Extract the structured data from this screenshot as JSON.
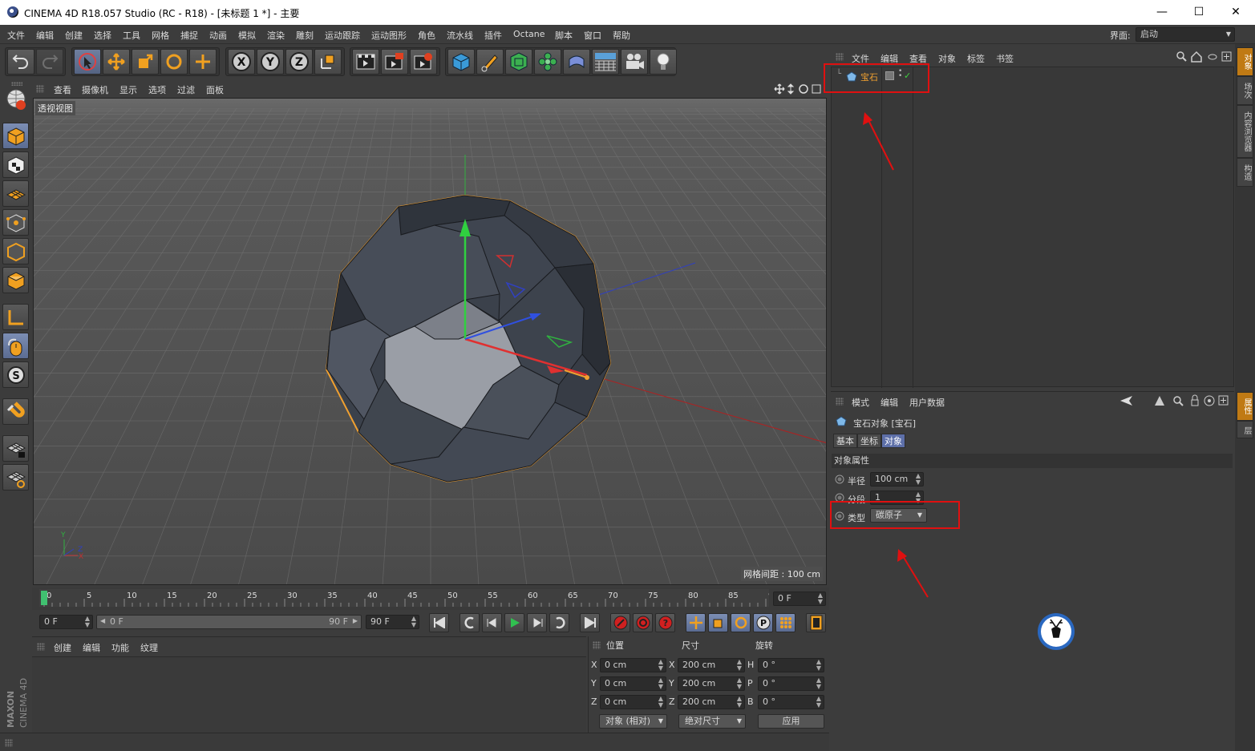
{
  "window": {
    "title": "CINEMA 4D R18.057 Studio (RC - R18) - [未标题 1 *] - 主要",
    "minimize": "—",
    "maximize": "☐",
    "close": "✕"
  },
  "menubar": {
    "items": [
      "文件",
      "编辑",
      "创建",
      "选择",
      "工具",
      "网格",
      "捕捉",
      "动画",
      "模拟",
      "渲染",
      "雕刻",
      "运动跟踪",
      "运动图形",
      "角色",
      "流水线",
      "插件",
      "Octane",
      "脚本",
      "窗口",
      "帮助"
    ],
    "layout_label": "界面:",
    "layout_value": "启动"
  },
  "toolbar": {
    "axis_x": "X",
    "axis_y": "Y",
    "axis_z": "Z",
    "icons": [
      "undo-icon",
      "redo-icon",
      "live-select-icon",
      "move-icon",
      "scale-icon",
      "rotate-icon",
      "transform-icon",
      "x-axis-icon",
      "y-axis-icon",
      "z-axis-icon",
      "coordinate-system-icon",
      "render-view-icon",
      "render-picture-viewer-icon",
      "render-settings-icon",
      "cube-icon",
      "pen-icon",
      "subdivision-icon",
      "cloner-icon",
      "deformer-icon",
      "floor-icon",
      "camera-icon",
      "light-icon"
    ]
  },
  "viewport": {
    "menu": [
      "查看",
      "摄像机",
      "显示",
      "选项",
      "过滤",
      "面板"
    ],
    "camera_label": "透视视图",
    "grid_spacing": "网格间距 : 100 cm",
    "axis_x": "X",
    "axis_y": "Y",
    "axis_z": "Z"
  },
  "timeline": {
    "ticks": [
      "0",
      "5",
      "10",
      "15",
      "20",
      "25",
      "30",
      "35",
      "40",
      "45",
      "50",
      "55",
      "60",
      "65",
      "70",
      "75",
      "80",
      "85",
      "90"
    ],
    "current_frame": "0 F"
  },
  "transport": {
    "start_frame": "0 F",
    "range_start": "0 F",
    "range_end": "90 F",
    "end_frame": "90 F"
  },
  "material_manager": {
    "menu": [
      "创建",
      "编辑",
      "功能",
      "纹理"
    ]
  },
  "coordinates": {
    "headers": [
      "位置",
      "尺寸",
      "旋转"
    ],
    "rows": [
      {
        "axis": "X",
        "pos": "0 cm",
        "size_axis": "X",
        "size": "200 cm",
        "rot_axis": "H",
        "rot": "0 °"
      },
      {
        "axis": "Y",
        "pos": "0 cm",
        "size_axis": "Y",
        "size": "200 cm",
        "rot_axis": "P",
        "rot": "0 °"
      },
      {
        "axis": "Z",
        "pos": "0 cm",
        "size_axis": "Z",
        "size": "200 cm",
        "rot_axis": "B",
        "rot": "0 °"
      }
    ],
    "mode": "对象 (相对)",
    "size_mode": "绝对尺寸",
    "apply": "应用"
  },
  "object_manager": {
    "menu": [
      "文件",
      "编辑",
      "查看",
      "对象",
      "标签",
      "书签"
    ],
    "objects": [
      {
        "name": "宝石",
        "icon": "gem-icon",
        "check": "✓"
      }
    ]
  },
  "attribute_manager": {
    "menu": [
      "模式",
      "编辑",
      "用户数据"
    ],
    "object_title": "宝石对象 [宝石]",
    "tabs": [
      "基本",
      "坐标",
      "对象"
    ],
    "active_tab": "对象",
    "section": "对象属性",
    "radius_label": "半径",
    "radius_value": "100 cm",
    "segments_label": "分段",
    "segments_value": "1",
    "type_label": "类型",
    "type_value": "碳原子"
  },
  "right_tabs": [
    "对象",
    "场次",
    "内容浏览器",
    "构造",
    "属性",
    "层"
  ],
  "branding": {
    "maxon": "MAXON",
    "product": "CINEMA 4D"
  },
  "colors": {
    "accent": "#c07a14",
    "selection": "#f0a030",
    "annotation": "#e01010"
  }
}
